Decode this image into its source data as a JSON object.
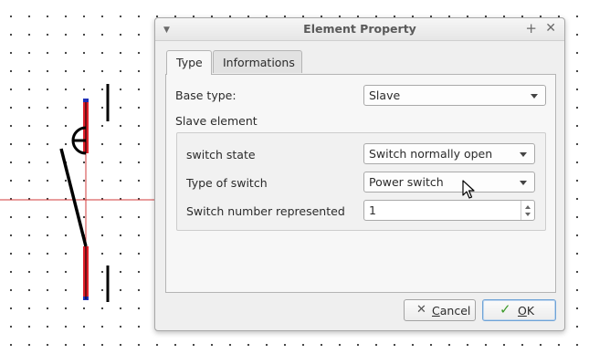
{
  "dialog": {
    "title": "Element Property",
    "icons": {
      "menu": "dropdown-menu-icon",
      "pin": "pin-plus-icon",
      "close": "close-icon"
    }
  },
  "tabs": [
    {
      "label": "Type",
      "active": true
    },
    {
      "label": "Informations",
      "active": false
    }
  ],
  "base_type": {
    "label": "Base type:",
    "value": "Slave"
  },
  "slave_element": {
    "title": "Slave element",
    "switch_state": {
      "label": "switch state",
      "value": "Switch normally open"
    },
    "switch_type": {
      "label": "Type of switch",
      "value": "Power switch"
    },
    "switch_number": {
      "label": "Switch number represented",
      "value": "1"
    }
  },
  "buttons": {
    "cancel_label": "Cancel",
    "cancel_mnemonic": "C",
    "cancel_rest": "ancel",
    "ok_label": "OK",
    "ok_mnemonic": "O",
    "ok_rest": "K"
  },
  "colors": {
    "accent": "#6fa3d6",
    "terminal_red": "#e0202a",
    "terminal_blue": "#1e2fb8",
    "crosshair": "#d23b3b",
    "ok_check": "#3c9a2a"
  }
}
